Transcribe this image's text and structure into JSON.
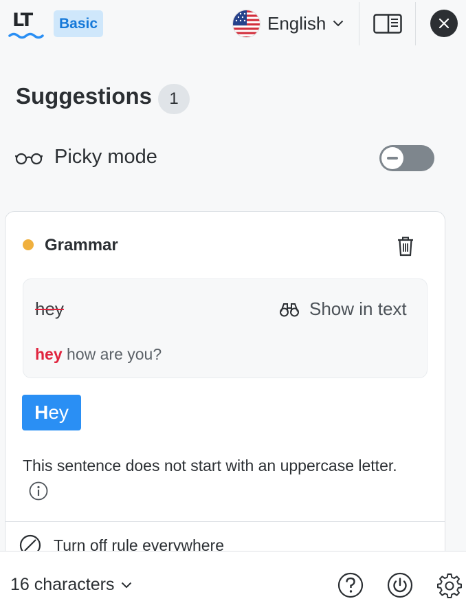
{
  "header": {
    "logo_text": "LT",
    "plan_badge": "Basic",
    "language": "English",
    "icons": [
      "chevron-down-icon",
      "sidebar-panel-icon",
      "close-icon"
    ]
  },
  "suggestions": {
    "title": "Suggestions",
    "count": "1"
  },
  "picky_mode": {
    "label": "Picky mode",
    "enabled": false
  },
  "card": {
    "category": "Grammar",
    "category_color": "#f0b03e",
    "original_word": "hey",
    "show_in_text_label": "Show in text",
    "context_highlight": "hey",
    "context_rest": " how are you?",
    "replacement_first": "H",
    "replacement_rest": "ey",
    "message": "This sentence does not start with an uppercase letter.",
    "turn_off_label": "Turn off rule everywhere"
  },
  "footer": {
    "char_count_label": "16 characters",
    "icons": [
      "help-icon",
      "power-icon",
      "settings-icon"
    ]
  },
  "colors": {
    "accent": "#2a8ff4",
    "error": "#e0243e",
    "badge_bg": "#cfe7fb",
    "badge_fg": "#1679d9"
  }
}
